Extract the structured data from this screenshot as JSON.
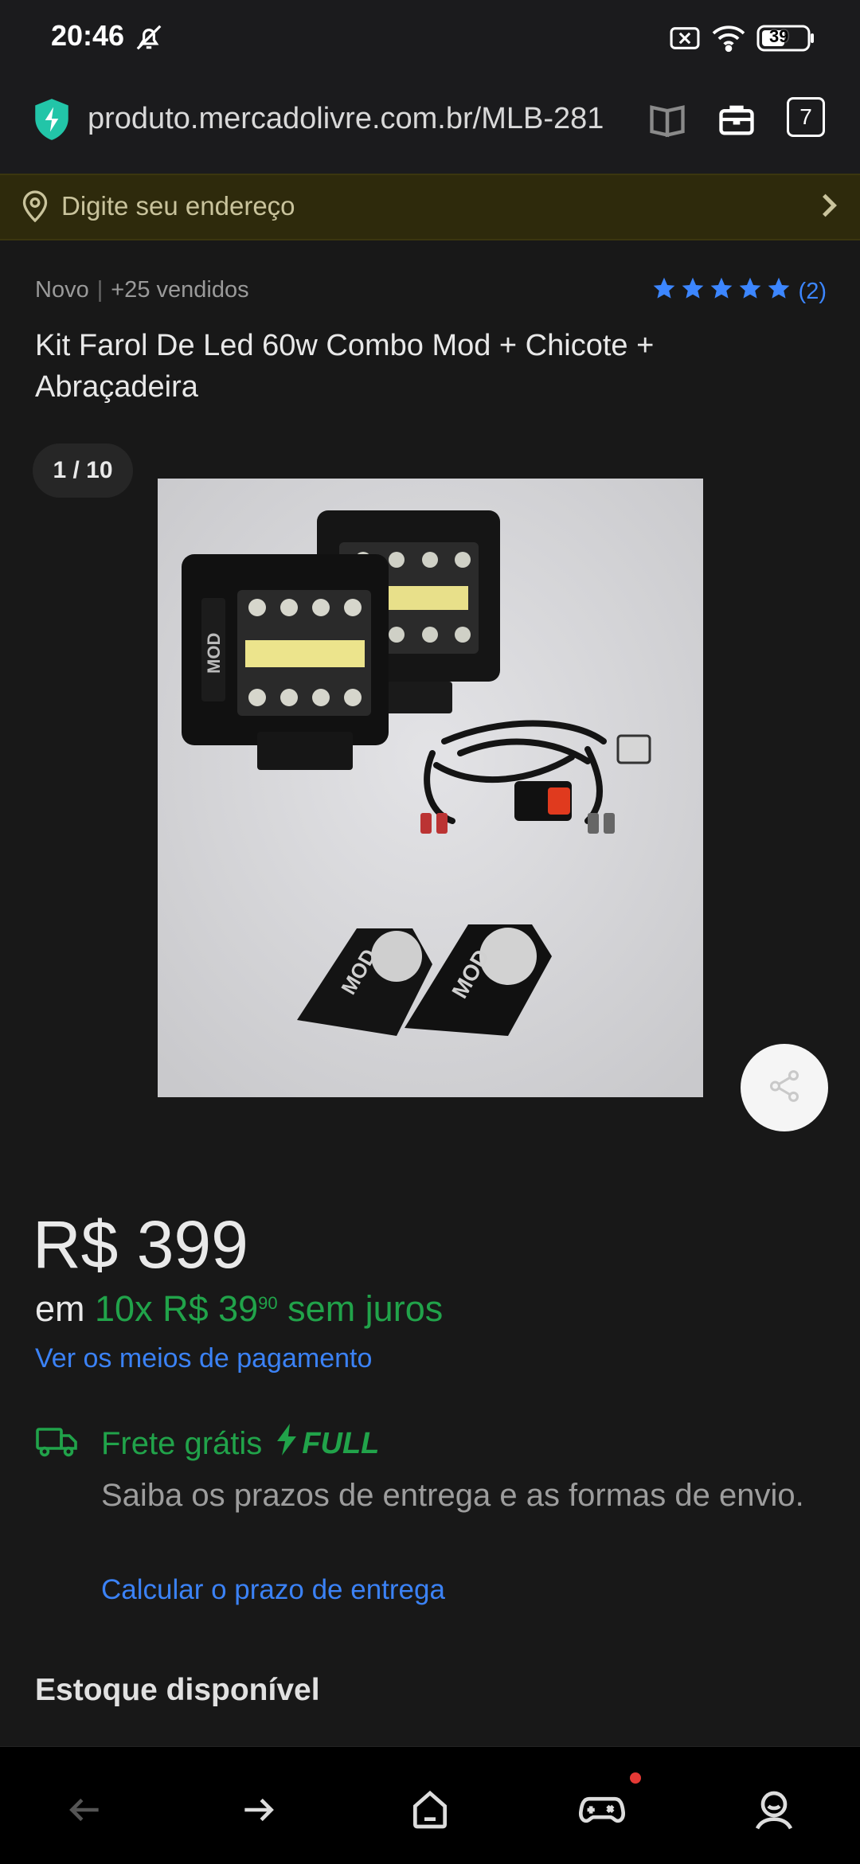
{
  "status_bar": {
    "time": "20:46",
    "battery": "39",
    "icons": [
      "mute-bell-icon",
      "sim-off-icon",
      "wifi-icon",
      "battery-icon"
    ]
  },
  "browser": {
    "url": "produto.mercadolivre.com.br/MLB-281",
    "tab_count": "7",
    "icons": [
      "secure-shield-icon",
      "reader-icon",
      "toolbox-icon",
      "tabs-icon"
    ]
  },
  "address_prompt": {
    "text": "Digite seu endereço"
  },
  "product": {
    "condition": "Novo",
    "sold": "+25 vendidos",
    "rating_count": "(2)",
    "stars": 5,
    "title": "Kit Farol De Led 60w Combo Mod + Chicote + Abraçadeira",
    "image_counter": "1 / 10"
  },
  "pricing": {
    "price": "R$ 399",
    "installment_prefix": "em",
    "installment_value": "10x R$ 39",
    "installment_cents": "90",
    "installment_suffix": "sem juros",
    "payment_link": "Ver os meios de pagamento"
  },
  "shipping": {
    "free_label": "Frete grátis",
    "full_label": "FULL",
    "description": "Saiba os prazos de entrega e as formas de envio.",
    "calc_link": "Calcular o prazo de entrega"
  },
  "stock": {
    "label": "Estoque disponível"
  },
  "colors": {
    "accent_blue": "#3b82f6",
    "accent_green": "#21a34a",
    "background": "#181818"
  }
}
